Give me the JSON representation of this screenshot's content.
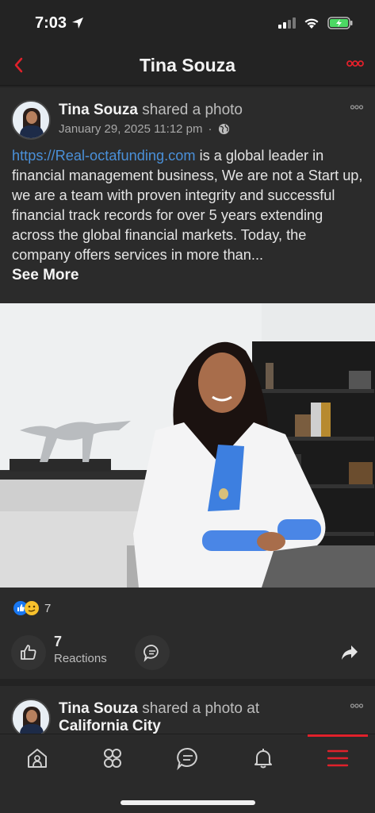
{
  "status_bar": {
    "time": "7:03",
    "icons": [
      "location-arrow-icon",
      "signal-icon",
      "wifi-icon",
      "battery-charging-icon"
    ]
  },
  "nav": {
    "title": "Tina Souza",
    "back_icon": "chevron-left-icon",
    "more_icon": "more-icon",
    "accent": "#e0212b"
  },
  "post1": {
    "author": "Tina Souza",
    "action": " shared a photo",
    "date": "January 29, 2025 11:12 pm",
    "separator": "·",
    "privacy_icon": "globe-icon",
    "text_link": "https://Real-octafunding.com",
    "text_body": " is a global leader in financial management business, We are not a Start up, we are a team with proven integrity and successful financial track records for over 5 years extending across the global financial markets. Today, the company offers services in more than...",
    "see_more": "See More",
    "reaction_count": "7",
    "reactions_num": "7",
    "reactions_label": "Reactions"
  },
  "post2": {
    "author": "Tina Souza",
    "action": " shared a photo at",
    "location": "California City"
  },
  "tabbar": {
    "items": [
      "home-icon",
      "groups-icon",
      "messages-icon",
      "notifications-icon",
      "menu-icon"
    ],
    "active": "menu-icon"
  }
}
